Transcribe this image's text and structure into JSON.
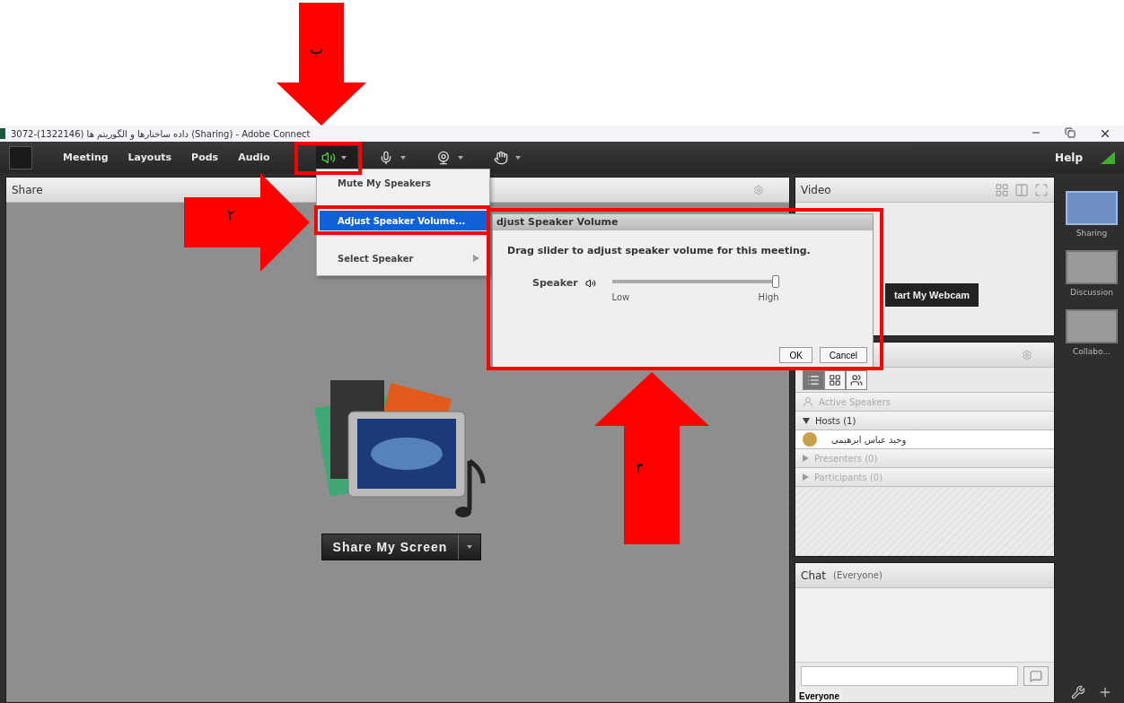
{
  "annotations": {
    "arrows": [
      {
        "kind": "down",
        "label": "ب"
      },
      {
        "kind": "right",
        "label": "۲"
      },
      {
        "kind": "up",
        "label": "۳"
      }
    ]
  },
  "window": {
    "title": "3072-(1322146) داده ساختارها و الگوریتم ها (Sharing) - Adobe Connect"
  },
  "menu_bar": {
    "items": [
      "Meeting",
      "Layouts",
      "Pods",
      "Audio"
    ],
    "speaker_on": true,
    "help": "Help"
  },
  "speaker_menu": {
    "items": [
      {
        "label": "Mute My Speakers",
        "selected": false,
        "submenu": false
      },
      {
        "label": "Adjust Speaker Volume...",
        "selected": true,
        "submenu": false
      },
      {
        "label": "Select Speaker",
        "selected": false,
        "submenu": true
      }
    ]
  },
  "share_pod": {
    "title": "Share",
    "button": "Share My Screen"
  },
  "dialog": {
    "title": "djust Speaker Volume",
    "message": "Drag slider to adjust speaker volume for this meeting.",
    "slider_label": "Speaker",
    "level": 1.0,
    "low": "Low",
    "high": "High",
    "buttons": [
      "OK",
      "Cancel"
    ]
  },
  "video_pod": {
    "title": "Video",
    "button": "tart My Webcam"
  },
  "attendees_pod": {
    "rows": [
      {
        "kind": "speakers",
        "label": "Active Speakers",
        "disabled": true
      },
      {
        "kind": "group",
        "label": "Hosts (1)",
        "disabled": false,
        "expanded": true
      },
      {
        "kind": "person",
        "label": "وحید عباس ابرهیمی",
        "disabled": false
      },
      {
        "kind": "group",
        "label": "Presenters (0)",
        "disabled": true,
        "expanded": false
      },
      {
        "kind": "group",
        "label": "Participants (0)",
        "disabled": true,
        "expanded": false
      }
    ]
  },
  "chat_pod": {
    "title": "Chat",
    "audience": "(Everyone)",
    "tab": "Everyone"
  },
  "layouts": [
    {
      "label": "Sharing",
      "selected": true
    },
    {
      "label": "Discussion",
      "selected": false
    },
    {
      "label": "Collabo...",
      "selected": false
    }
  ]
}
